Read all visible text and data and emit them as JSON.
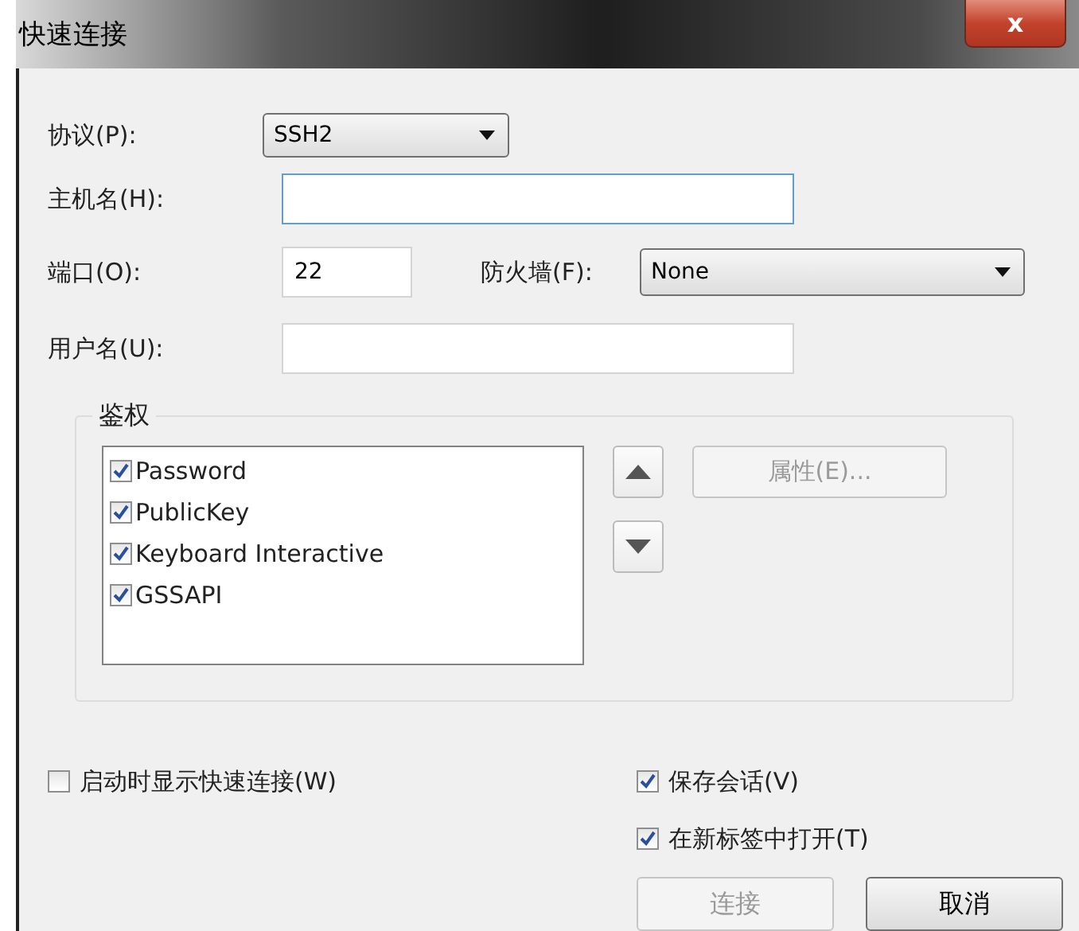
{
  "window": {
    "title": "快速连接",
    "close": "x"
  },
  "protocol": {
    "label": "协议(P):",
    "value": "SSH2"
  },
  "hostname": {
    "label": "主机名(H):",
    "focused": true
  },
  "port": {
    "label": "端口(O):",
    "value": "22"
  },
  "firewall": {
    "label": "防火墙(F):",
    "value": "None"
  },
  "username": {
    "label": "用户名(U):"
  },
  "auth": {
    "title": "鉴权",
    "methods": [
      {
        "label": "Password",
        "checked": true
      },
      {
        "label": "PublicKey",
        "checked": true
      },
      {
        "label": "Keyboard Interactive",
        "checked": true
      },
      {
        "label": "GSSAPI",
        "checked": true
      }
    ],
    "properties_button": {
      "label": "属性(E)...",
      "disabled": true
    }
  },
  "options": [
    {
      "label": "启动时显示快速连接(W)",
      "checked": false
    },
    {
      "label": "保存会话(V)",
      "checked": true
    },
    {
      "label": "在新标签中打开(T)",
      "checked": true
    }
  ],
  "buttons": [
    {
      "label": "连接",
      "disabled": true
    },
    {
      "label": "取消",
      "disabled": false
    }
  ]
}
